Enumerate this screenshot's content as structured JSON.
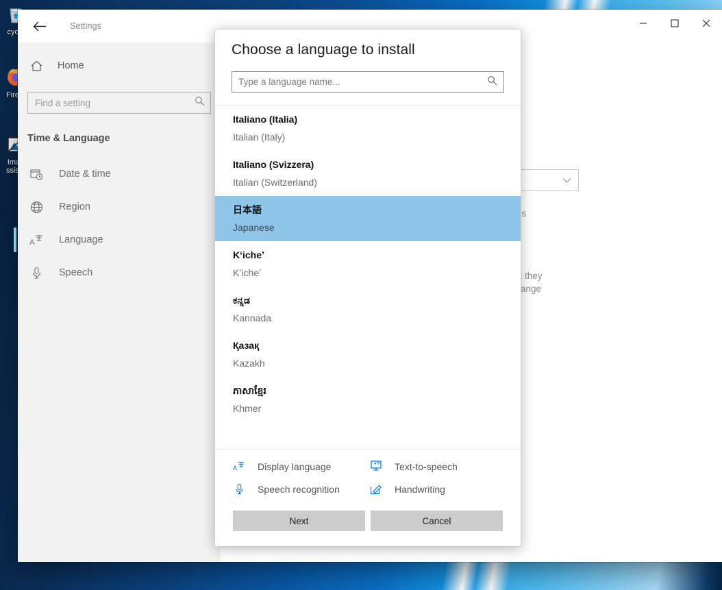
{
  "desktop": {
    "icons": [
      {
        "name": "recycle-bin",
        "label": "cycle",
        "glyph": "♻"
      },
      {
        "name": "firefox",
        "label": "Firefo",
        "glyph": "🦊"
      },
      {
        "name": "image-assistant",
        "label": "Imag",
        "label2": "ssista",
        "glyph": "◧"
      }
    ]
  },
  "window": {
    "title": "Settings",
    "back_label": "←",
    "controls": {
      "minimize": "—",
      "maximize": "☐",
      "close": "✕"
    }
  },
  "sidebar": {
    "home_label": "Home",
    "home_icon": "home-icon",
    "search": {
      "placeholder": "Find a setting",
      "value": "",
      "icon": "search-icon"
    },
    "section_title": "Time & Language",
    "items": [
      {
        "label": "Date & time",
        "icon": "calendar-clock-icon",
        "selected": false
      },
      {
        "label": "Region",
        "icon": "globe-icon",
        "selected": false
      },
      {
        "label": "Language",
        "icon": "language-icon",
        "selected": true
      },
      {
        "label": "Speech",
        "icon": "microphone-icon",
        "selected": false
      }
    ]
  },
  "content_behind": {
    "combo_chevron": "∨",
    "fragment_1": "his",
    "fragment_2": "at they",
    "fragment_3": "rrange",
    "mini_icon_1": "handwriting-icon",
    "mini_icon_2": "keyboard-icon"
  },
  "dialog": {
    "title": "Choose a language to install",
    "search": {
      "placeholder": "Type a language name...",
      "value": "",
      "icon": "search-icon"
    },
    "languages": [
      {
        "native": "Italiano (Italia)",
        "english": "Italian (Italy)",
        "selected": false
      },
      {
        "native": "Italiano (Svizzera)",
        "english": "Italian (Switzerland)",
        "selected": false
      },
      {
        "native": "日本語",
        "english": "Japanese",
        "selected": true
      },
      {
        "native": "Kʻicheʼ",
        "english": "Kʻicheʼ",
        "selected": false
      },
      {
        "native": "ಕನ್ನಡ",
        "english": "Kannada",
        "selected": false
      },
      {
        "native": "Қазақ",
        "english": "Kazakh",
        "selected": false
      },
      {
        "native": "ភាសាខ្មែរ",
        "english": "Khmer",
        "selected": false
      }
    ],
    "capabilities": [
      {
        "label": "Display language",
        "icon": "display-language-icon"
      },
      {
        "label": "Text-to-speech",
        "icon": "text-to-speech-icon"
      },
      {
        "label": "Speech recognition",
        "icon": "microphone-icon"
      },
      {
        "label": "Handwriting",
        "icon": "handwriting-icon"
      }
    ],
    "buttons": {
      "next": "Next",
      "cancel": "Cancel"
    }
  },
  "colors": {
    "accent": "#0078d7",
    "selection": "#8ec5e8",
    "button": "#cccccc",
    "sidebar": "#f2f2f2"
  }
}
